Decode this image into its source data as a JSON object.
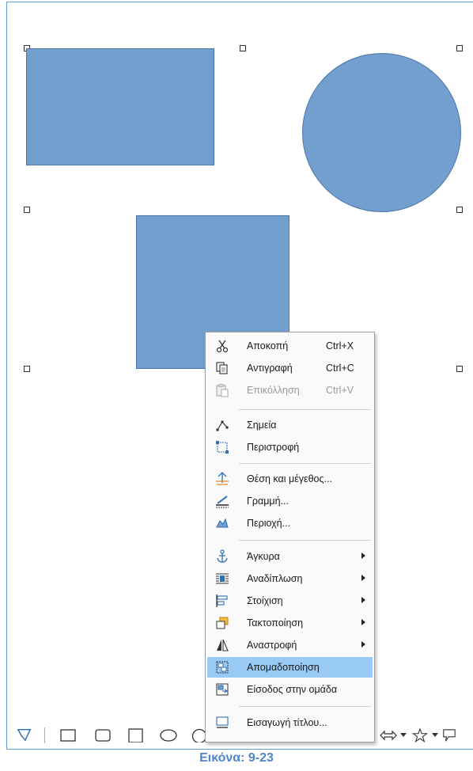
{
  "menu": {
    "items": [
      {
        "label": "Αποκοπή",
        "shortcut": "Ctrl+X",
        "icon": "cut-icon",
        "enabled": true
      },
      {
        "label": "Αντιγραφή",
        "shortcut": "Ctrl+C",
        "icon": "copy-icon",
        "enabled": true
      },
      {
        "label": "Επικόλληση",
        "shortcut": "Ctrl+V",
        "icon": "paste-icon",
        "enabled": false
      },
      {
        "label": "Σημεία",
        "icon": "points-icon",
        "enabled": true
      },
      {
        "label": "Περιστροφή",
        "icon": "rotate-icon",
        "enabled": true
      },
      {
        "label": "Θέση και μέγεθος...",
        "icon": "position-size-icon",
        "enabled": true
      },
      {
        "label": "Γραμμή...",
        "icon": "line-icon",
        "enabled": true
      },
      {
        "label": "Περιοχή...",
        "icon": "area-icon",
        "enabled": true
      },
      {
        "label": "Άγκυρα",
        "icon": "anchor-icon",
        "submenu": true
      },
      {
        "label": "Αναδίπλωση",
        "icon": "wrap-icon",
        "submenu": true
      },
      {
        "label": "Στοίχιση",
        "icon": "align-icon",
        "submenu": true
      },
      {
        "label": "Τακτοποίηση",
        "icon": "arrange-icon",
        "submenu": true
      },
      {
        "label": "Αναστροφή",
        "icon": "flip-icon",
        "submenu": true
      },
      {
        "label": "Απομαδοποίηση",
        "icon": "ungroup-icon",
        "highlighted": true
      },
      {
        "label": "Είσοδος στην ομάδα",
        "icon": "enter-group-icon"
      },
      {
        "label": "Εισαγωγή τίτλου...",
        "icon": "insert-caption-icon"
      }
    ]
  },
  "colors": {
    "shape_fill": "#739fcf",
    "highlight": "#99c9f5",
    "caption": "#4f86c6"
  },
  "caption": "Εικόνα: 9-23"
}
